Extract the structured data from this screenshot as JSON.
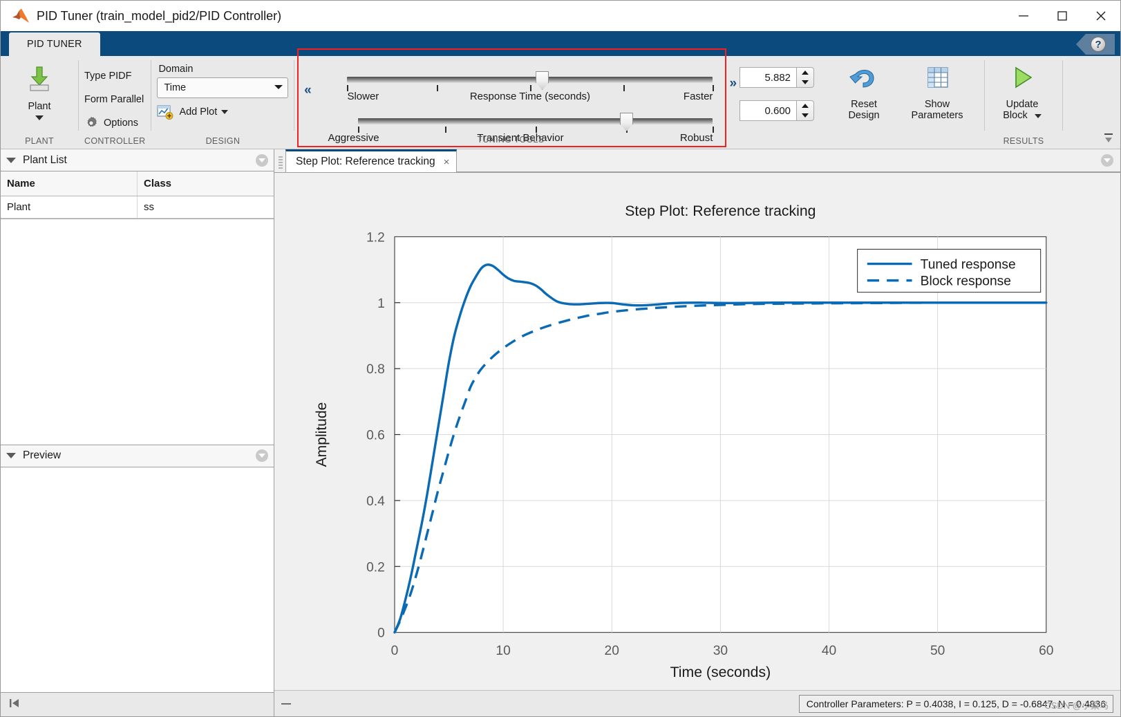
{
  "window": {
    "title": "PID Tuner (train_model_pid2/PID Controller)",
    "logo_icon": "matlab-logo-icon",
    "minimize_label": "Minimize",
    "maximize_label": "Maximize",
    "close_label": "Close"
  },
  "ribbon": {
    "tab_label": "PID TUNER",
    "help_glyph": "?",
    "collapse_glyph": "⬆",
    "groups": {
      "plant": {
        "label": "PLANT",
        "button_label": "Plant",
        "icon": "import-plant-icon"
      },
      "controller": {
        "label": "CONTROLLER",
        "type_row": "Type PIDF",
        "form_row": "Form Parallel",
        "options_label": "Options",
        "options_icon": "gear-icon"
      },
      "design": {
        "label": "DESIGN",
        "domain_caption": "Domain",
        "domain_value": "Time",
        "add_plot_label": "Add Plot",
        "add_plot_icon": "add-plot-icon"
      },
      "tuning": {
        "label": "TUNING TOOLS",
        "expand_left_glyph": "«",
        "expand_right_glyph": "»",
        "highlight_color": "#f42020",
        "sliders": [
          {
            "name": "response-time",
            "center_label": "Response Time (seconds)",
            "left_label": "Slower",
            "right_label": "Faster",
            "thumb_percent": 48,
            "tick_percents": [
              0,
              24.5,
              50,
              75.5,
              100
            ]
          },
          {
            "name": "transient-behavior",
            "center_label": "Transient Behavior",
            "left_label": "Aggressive",
            "right_label": "Robust",
            "thumb_percent": 66,
            "tick_percents": [
              0,
              24.5,
              50,
              75.5,
              100
            ]
          }
        ],
        "response_time_value": "5.882",
        "transient_value": "0.600"
      },
      "results": {
        "label": "RESULTS",
        "reset_design_label": "Reset\nDesign",
        "reset_design_line1": "Reset",
        "reset_design_line2": "Design",
        "reset_icon": "undo-arrow-icon",
        "show_parameters_line1": "Show",
        "show_parameters_line2": "Parameters",
        "show_parameters_icon": "table-grid-icon",
        "update_block_line1": "Update",
        "update_block_line2": "Block",
        "update_icon": "play-triangle-icon"
      }
    }
  },
  "left_panel": {
    "plant_list": {
      "title": "Plant List",
      "collapse_icon": "chevron-down-circle-icon",
      "columns": [
        "Name",
        "Class"
      ],
      "rows": [
        {
          "name": "Plant",
          "class": "ss"
        }
      ]
    },
    "preview": {
      "title": "Preview",
      "collapse_icon": "chevron-down-circle-icon"
    },
    "footer_icon": "go-to-start-icon"
  },
  "document": {
    "tab_label": "Step Plot: Reference tracking",
    "close_glyph": "×",
    "panel_collapse_icon": "chevron-down-circle-icon"
  },
  "status": {
    "text": "Controller Parameters: P = 0.4038, I = 0.125, D = -0.6847, N = 0.4836",
    "watermark": "CSDN @小菜鸟",
    "split_icon": "horizontal-split-icon"
  },
  "chart_data": {
    "type": "line",
    "title": "Step Plot: Reference tracking",
    "xlabel": "Time (seconds)",
    "ylabel": "Amplitude",
    "xlim": [
      0,
      60
    ],
    "ylim": [
      0,
      1.2
    ],
    "xticks": [
      0,
      10,
      20,
      30,
      40,
      50,
      60
    ],
    "yticks": [
      0,
      0.2,
      0.4,
      0.6,
      0.8,
      1,
      1.2
    ],
    "ytick_labels": [
      "0",
      "0.2",
      "0.4",
      "0.6",
      "0.8",
      "1",
      "1.2"
    ],
    "grid": true,
    "legend_position": "top-right",
    "line_color": "#0a6ab4",
    "series": [
      {
        "name": "Tuned response",
        "style": "solid",
        "x": [
          0,
          0.5,
          1,
          1.5,
          2,
          2.5,
          3,
          3.5,
          4,
          4.5,
          5,
          5.5,
          6,
          6.5,
          7,
          7.5,
          8,
          8.5,
          9,
          9.5,
          10,
          10.5,
          11,
          11.5,
          12,
          12.5,
          13,
          13.5,
          14,
          15,
          16,
          17,
          18,
          19,
          20,
          21,
          22,
          23,
          24,
          25,
          26,
          28,
          30,
          32,
          35,
          40,
          45,
          50,
          55,
          60
        ],
        "y": [
          0,
          0.04,
          0.1,
          0.17,
          0.25,
          0.33,
          0.42,
          0.52,
          0.62,
          0.72,
          0.82,
          0.9,
          0.96,
          1.01,
          1.05,
          1.08,
          1.105,
          1.115,
          1.112,
          1.1,
          1.085,
          1.073,
          1.066,
          1.064,
          1.062,
          1.059,
          1.052,
          1.04,
          1.025,
          1.003,
          0.996,
          0.995,
          0.997,
          0.999,
          0.999,
          0.995,
          0.992,
          0.992,
          0.994,
          0.997,
          0.999,
          1.0,
          0.999,
          0.999,
          1.0,
          1.0,
          1.0,
          1.0,
          1.0,
          1.0
        ]
      },
      {
        "name": "Block response",
        "style": "dashed",
        "x": [
          0,
          0.5,
          1,
          1.5,
          2,
          2.5,
          3,
          3.5,
          4,
          4.5,
          5,
          5.5,
          6,
          6.5,
          7,
          7.5,
          8,
          9,
          10,
          11,
          12,
          13,
          14,
          15,
          16,
          17,
          18,
          19,
          20,
          22,
          24,
          26,
          28,
          30,
          33,
          36,
          40,
          45,
          50,
          55,
          60
        ],
        "y": [
          0,
          0.035,
          0.075,
          0.12,
          0.175,
          0.235,
          0.3,
          0.365,
          0.43,
          0.49,
          0.55,
          0.605,
          0.655,
          0.7,
          0.745,
          0.775,
          0.8,
          0.835,
          0.862,
          0.884,
          0.902,
          0.916,
          0.928,
          0.938,
          0.947,
          0.955,
          0.962,
          0.967,
          0.972,
          0.979,
          0.984,
          0.988,
          0.991,
          0.993,
          0.996,
          0.997,
          0.998,
          0.999,
          1.0,
          1.0,
          1.0
        ]
      }
    ]
  }
}
